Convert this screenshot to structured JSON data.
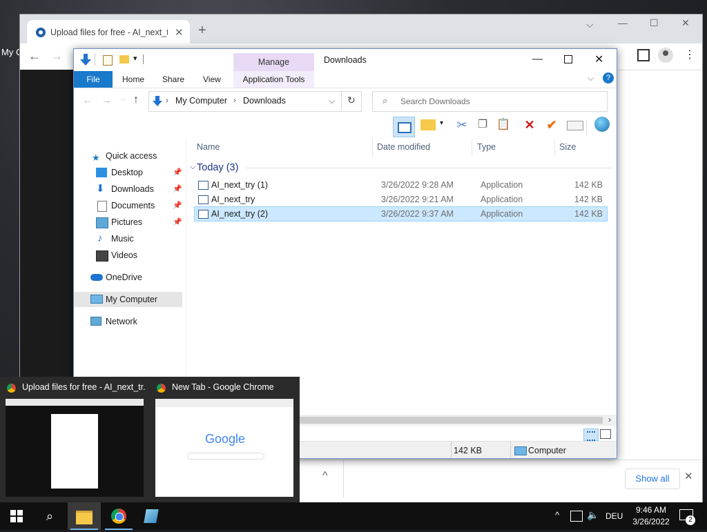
{
  "desktop": {
    "icon_label": "My C"
  },
  "chrome": {
    "tab_title": "Upload files for free - AI_next_try",
    "new_tab_label": "+",
    "downloads_bar": {
      "show_all": "Show all"
    }
  },
  "explorer": {
    "manage_label": "Manage",
    "window_title": "Downloads",
    "ribbon": {
      "file": "File",
      "home": "Home",
      "share": "Share",
      "view": "View",
      "application_tools": "Application Tools"
    },
    "breadcrumb": [
      "My Computer",
      "Downloads"
    ],
    "search_placeholder": "Search Downloads",
    "columns": {
      "name": "Name",
      "date_modified": "Date modified",
      "type": "Type",
      "size": "Size"
    },
    "group": "Today (3)",
    "files": [
      {
        "name": "AI_next_try (1)",
        "date": "3/26/2022 9:28 AM",
        "type": "Application",
        "size": "142 KB",
        "selected": false
      },
      {
        "name": "AI_next_try",
        "date": "3/26/2022 9:21 AM",
        "type": "Application",
        "size": "142 KB",
        "selected": false
      },
      {
        "name": "AI_next_try (2)",
        "date": "3/26/2022 9:37 AM",
        "type": "Application",
        "size": "142 KB",
        "selected": true
      }
    ],
    "nav": {
      "quick_access": "Quick access",
      "desktop": "Desktop",
      "downloads": "Downloads",
      "documents": "Documents",
      "pictures": "Pictures",
      "music": "Music",
      "videos": "Videos",
      "onedrive": "OneDrive",
      "my_computer": "My Computer",
      "network": "Network"
    },
    "status": {
      "size": "142 KB",
      "location": "Computer"
    }
  },
  "preview": {
    "item1_title": "Upload files for free - AI_next_tr...",
    "item2_title": "New Tab - Google Chrome",
    "google_logo": "Google"
  },
  "taskbar": {
    "language": "DEU",
    "time": "9:46 AM",
    "date": "3/26/2022",
    "notification_count": "2"
  },
  "colors": {
    "accent": "#1979ca",
    "selection": "#cce8ff",
    "manage": "#e8d9f5"
  }
}
